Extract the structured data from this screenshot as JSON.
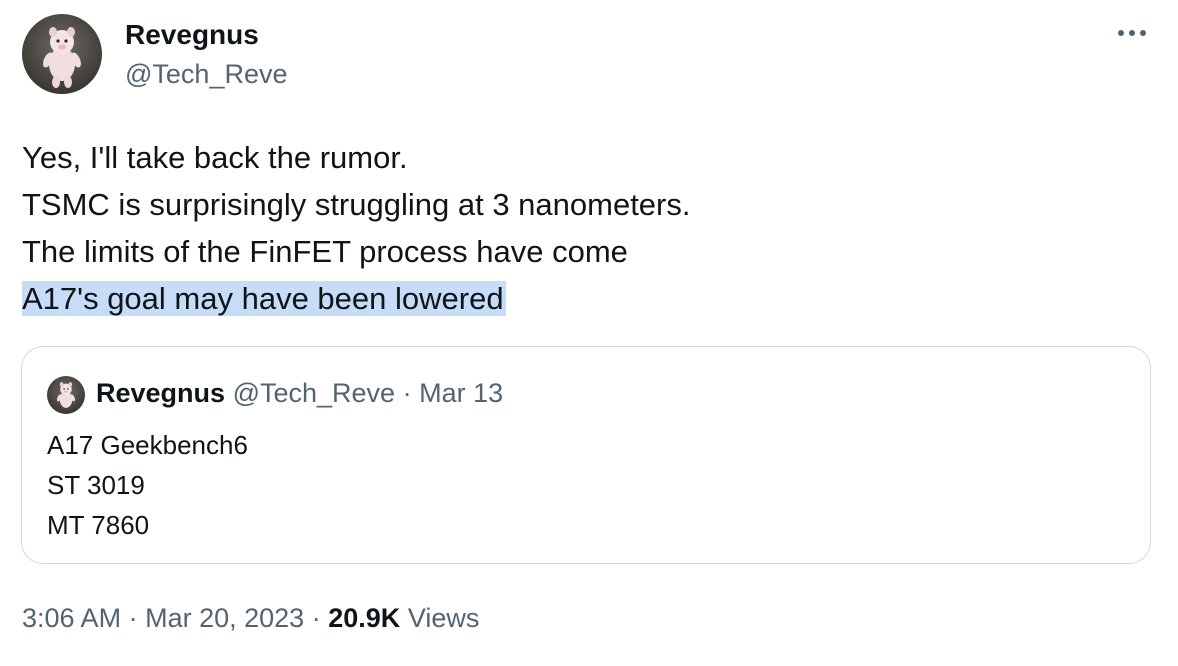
{
  "author": {
    "display_name": "Revegnus",
    "handle": "@Tech_Reve",
    "avatar_icon": "pig-figure-avatar"
  },
  "more_icon": "more-horizontal-icon",
  "tweet": {
    "lines": [
      "Yes, I'll take back the rumor.",
      "TSMC is surprisingly struggling at 3 nanometers.",
      "The limits of the FinFET process have come",
      "A17's goal may have been lowered"
    ],
    "highlight_color": "#c6dcf7"
  },
  "quoted_tweet": {
    "display_name": "Revegnus",
    "handle": "@Tech_Reve",
    "separator": "·",
    "date": "Mar 13",
    "lines": [
      "A17 Geekbench6",
      "ST 3019",
      "MT 7860"
    ]
  },
  "footer": {
    "time": "3:06 AM",
    "separator": "·",
    "date": "Mar 20, 2023",
    "views_count": "20.9K",
    "views_label": "Views"
  },
  "colors": {
    "text": "#0f1419",
    "secondary": "#536471",
    "border": "#cfd9de"
  }
}
